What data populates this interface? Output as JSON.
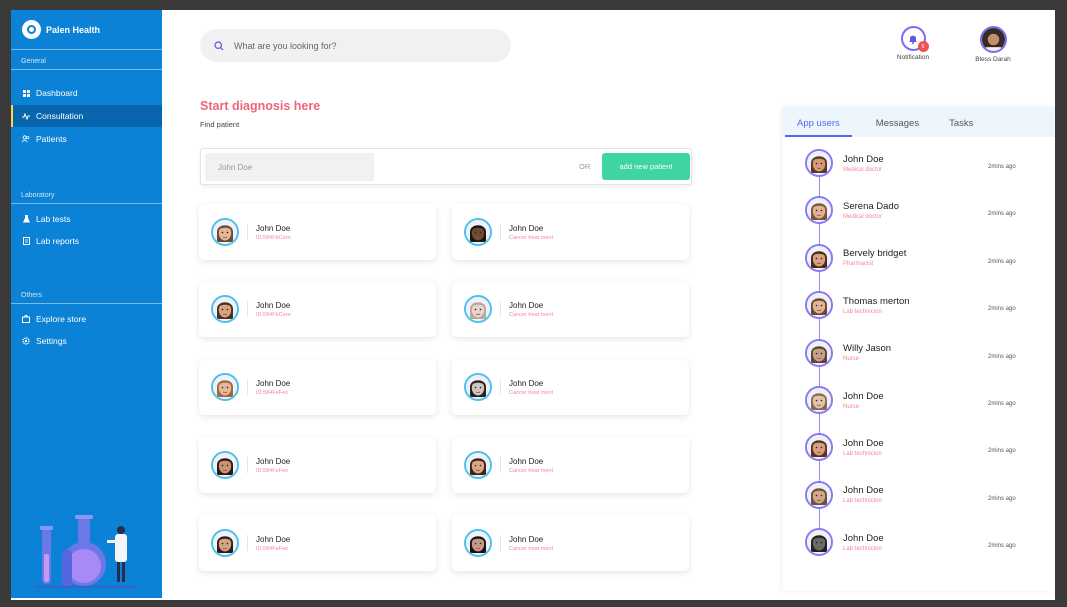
{
  "brand": {
    "name": "Palen Health"
  },
  "sidebar": {
    "sections": [
      {
        "label": "General",
        "items": [
          {
            "label": "Dashboard",
            "icon": "grid-icon"
          },
          {
            "label": "Consultation",
            "icon": "pulse-icon",
            "active": true
          },
          {
            "label": "Patients",
            "icon": "users-icon"
          }
        ]
      },
      {
        "label": "Laboratory",
        "items": [
          {
            "label": "Lab tests",
            "icon": "flask-icon"
          },
          {
            "label": "Lab reports",
            "icon": "document-icon"
          }
        ]
      },
      {
        "label": "Others",
        "items": [
          {
            "label": "Explore store",
            "icon": "bag-icon"
          },
          {
            "label": "Settings",
            "icon": "gear-icon"
          }
        ]
      }
    ]
  },
  "header": {
    "search_placeholder": "What are you looking for?",
    "notification_label": "Notification",
    "notification_count": "6",
    "user_name": "Bless Darah"
  },
  "main": {
    "title": "Start diagnosis here",
    "subtitle": "Find patient",
    "find_placeholder": "John Doe",
    "or_label": "OR",
    "add_button": "add new patient",
    "patients": [
      {
        "name": "John Doe",
        "sub": "ID:584FbCero",
        "skin": "#e2b79a",
        "hair": "#6b4a32"
      },
      {
        "name": "John Doe",
        "sub": "Cancer treat ment",
        "skin": "#6a4a38",
        "hair": "#1e1410"
      },
      {
        "name": "John Doe",
        "sub": "ID:584FbCero",
        "skin": "#d9a484",
        "hair": "#4a2e1e"
      },
      {
        "name": "John Doe",
        "sub": "Cancer treat ment",
        "skin": "#e6d4cc",
        "hair": "#b8a79e"
      },
      {
        "name": "John Doe",
        "sub": "ID:584FeFeo",
        "skin": "#e8b89a",
        "hair": "#9a6a42"
      },
      {
        "name": "John Doe",
        "sub": "Cancer treat ment",
        "skin": "#cfc6c0",
        "hair": "#2a2220"
      },
      {
        "name": "John Doe",
        "sub": "ID:584FeFeo",
        "skin": "#c99474",
        "hair": "#2a1a12"
      },
      {
        "name": "John Doe",
        "sub": "Cancer treat ment",
        "skin": "#d9a88c",
        "hair": "#3a2418"
      },
      {
        "name": "John Doe",
        "sub": "ID:584FeFeo",
        "skin": "#d4a286",
        "hair": "#2e1e16"
      },
      {
        "name": "John Doe",
        "sub": "Cancer treat ment",
        "skin": "#c59a86",
        "hair": "#1a1210"
      }
    ]
  },
  "panel": {
    "tabs": [
      {
        "label": "App users",
        "active": true
      },
      {
        "label": "Messages"
      },
      {
        "label": "Tasks"
      }
    ],
    "users": [
      {
        "name": "John Doe",
        "role": "Medical doctor",
        "time": "2mins ago",
        "skin": "#d69a78",
        "hair": "#5a3824"
      },
      {
        "name": "Serena Dado",
        "role": "Medical doctor",
        "time": "2mins ago",
        "skin": "#e0b092",
        "hair": "#7a5638"
      },
      {
        "name": "Bervely bridget",
        "role": "Pharmacist",
        "time": "2mins ago",
        "skin": "#d9a080",
        "hair": "#4a2a18"
      },
      {
        "name": "Thomas merton",
        "role": "Lab technicion",
        "time": "2mins ago",
        "skin": "#e0b498",
        "hair": "#6a4a30"
      },
      {
        "name": "Willy Jason",
        "role": "Nurse",
        "time": "2mins ago",
        "skin": "#c8a088",
        "hair": "#5a4636"
      },
      {
        "name": "John Doe",
        "role": "Nurse",
        "time": "2mins ago",
        "skin": "#e2c2b0",
        "hair": "#8a6a50"
      },
      {
        "name": "John Doe",
        "role": "Lab technicion",
        "time": "2mins ago",
        "skin": "#d8a080",
        "hair": "#5a3420"
      },
      {
        "name": "John Doe",
        "role": "Lab technicion",
        "time": "2mins ago",
        "skin": "#d0a888",
        "hair": "#6a5040"
      },
      {
        "name": "John Doe",
        "role": "Lab technicion",
        "time": "2mins ago",
        "skin": "#6a6a6a",
        "hair": "#222222"
      }
    ]
  },
  "colors": {
    "sidebar": "#0b82d6",
    "accent_pink": "#f0647a",
    "accent_green": "#3fd5a0",
    "accent_purple": "#7b6cf6",
    "tab_blue": "#4a6cf5"
  }
}
